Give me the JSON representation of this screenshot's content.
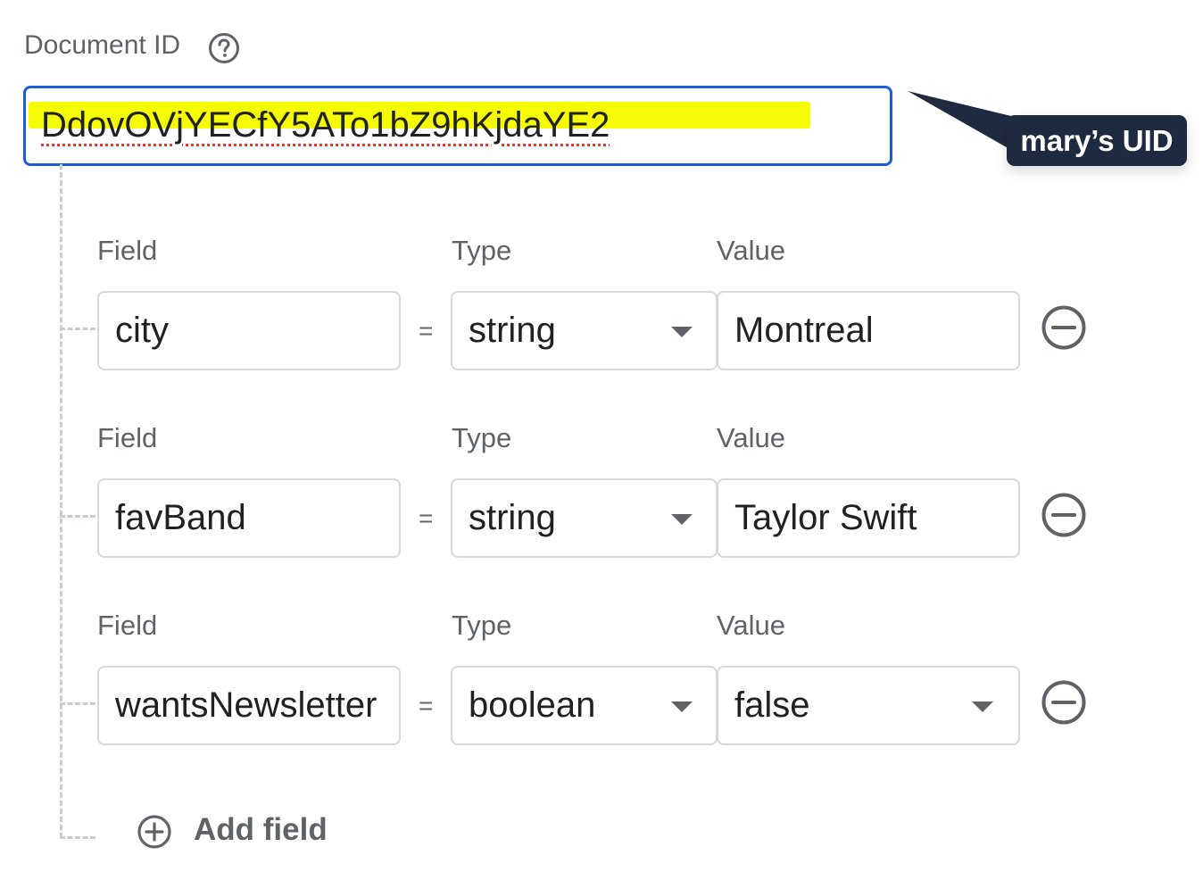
{
  "document": {
    "id_label": "Document ID",
    "id_value": "DdovOVjYECfY5ATo1bZ9hKjdaYE2"
  },
  "annotation": {
    "callout_text": "mary’s UID",
    "highlight_color": "#f4fb04",
    "callout_bg": "#1e2a3f"
  },
  "columns": {
    "field": "Field",
    "type": "Type",
    "value": "Value"
  },
  "operator": "=",
  "rows": [
    {
      "field": "city",
      "type": "string",
      "value": "Montreal",
      "value_is_select": false
    },
    {
      "field": "favBand",
      "type": "string",
      "value": "Taylor Swift",
      "value_is_select": false
    },
    {
      "field": "wantsNewsletter",
      "type": "boolean",
      "value": "false",
      "value_is_select": true
    }
  ],
  "add_field_label": "Add field",
  "icons": {
    "help": "help-circle-icon",
    "remove": "minus-circle-icon",
    "add": "plus-circle-icon",
    "dropdown": "chevron-down-icon"
  },
  "colors": {
    "focus_border": "#1a5ed8",
    "muted_text": "#5f6368",
    "box_border": "#d6d8db"
  }
}
